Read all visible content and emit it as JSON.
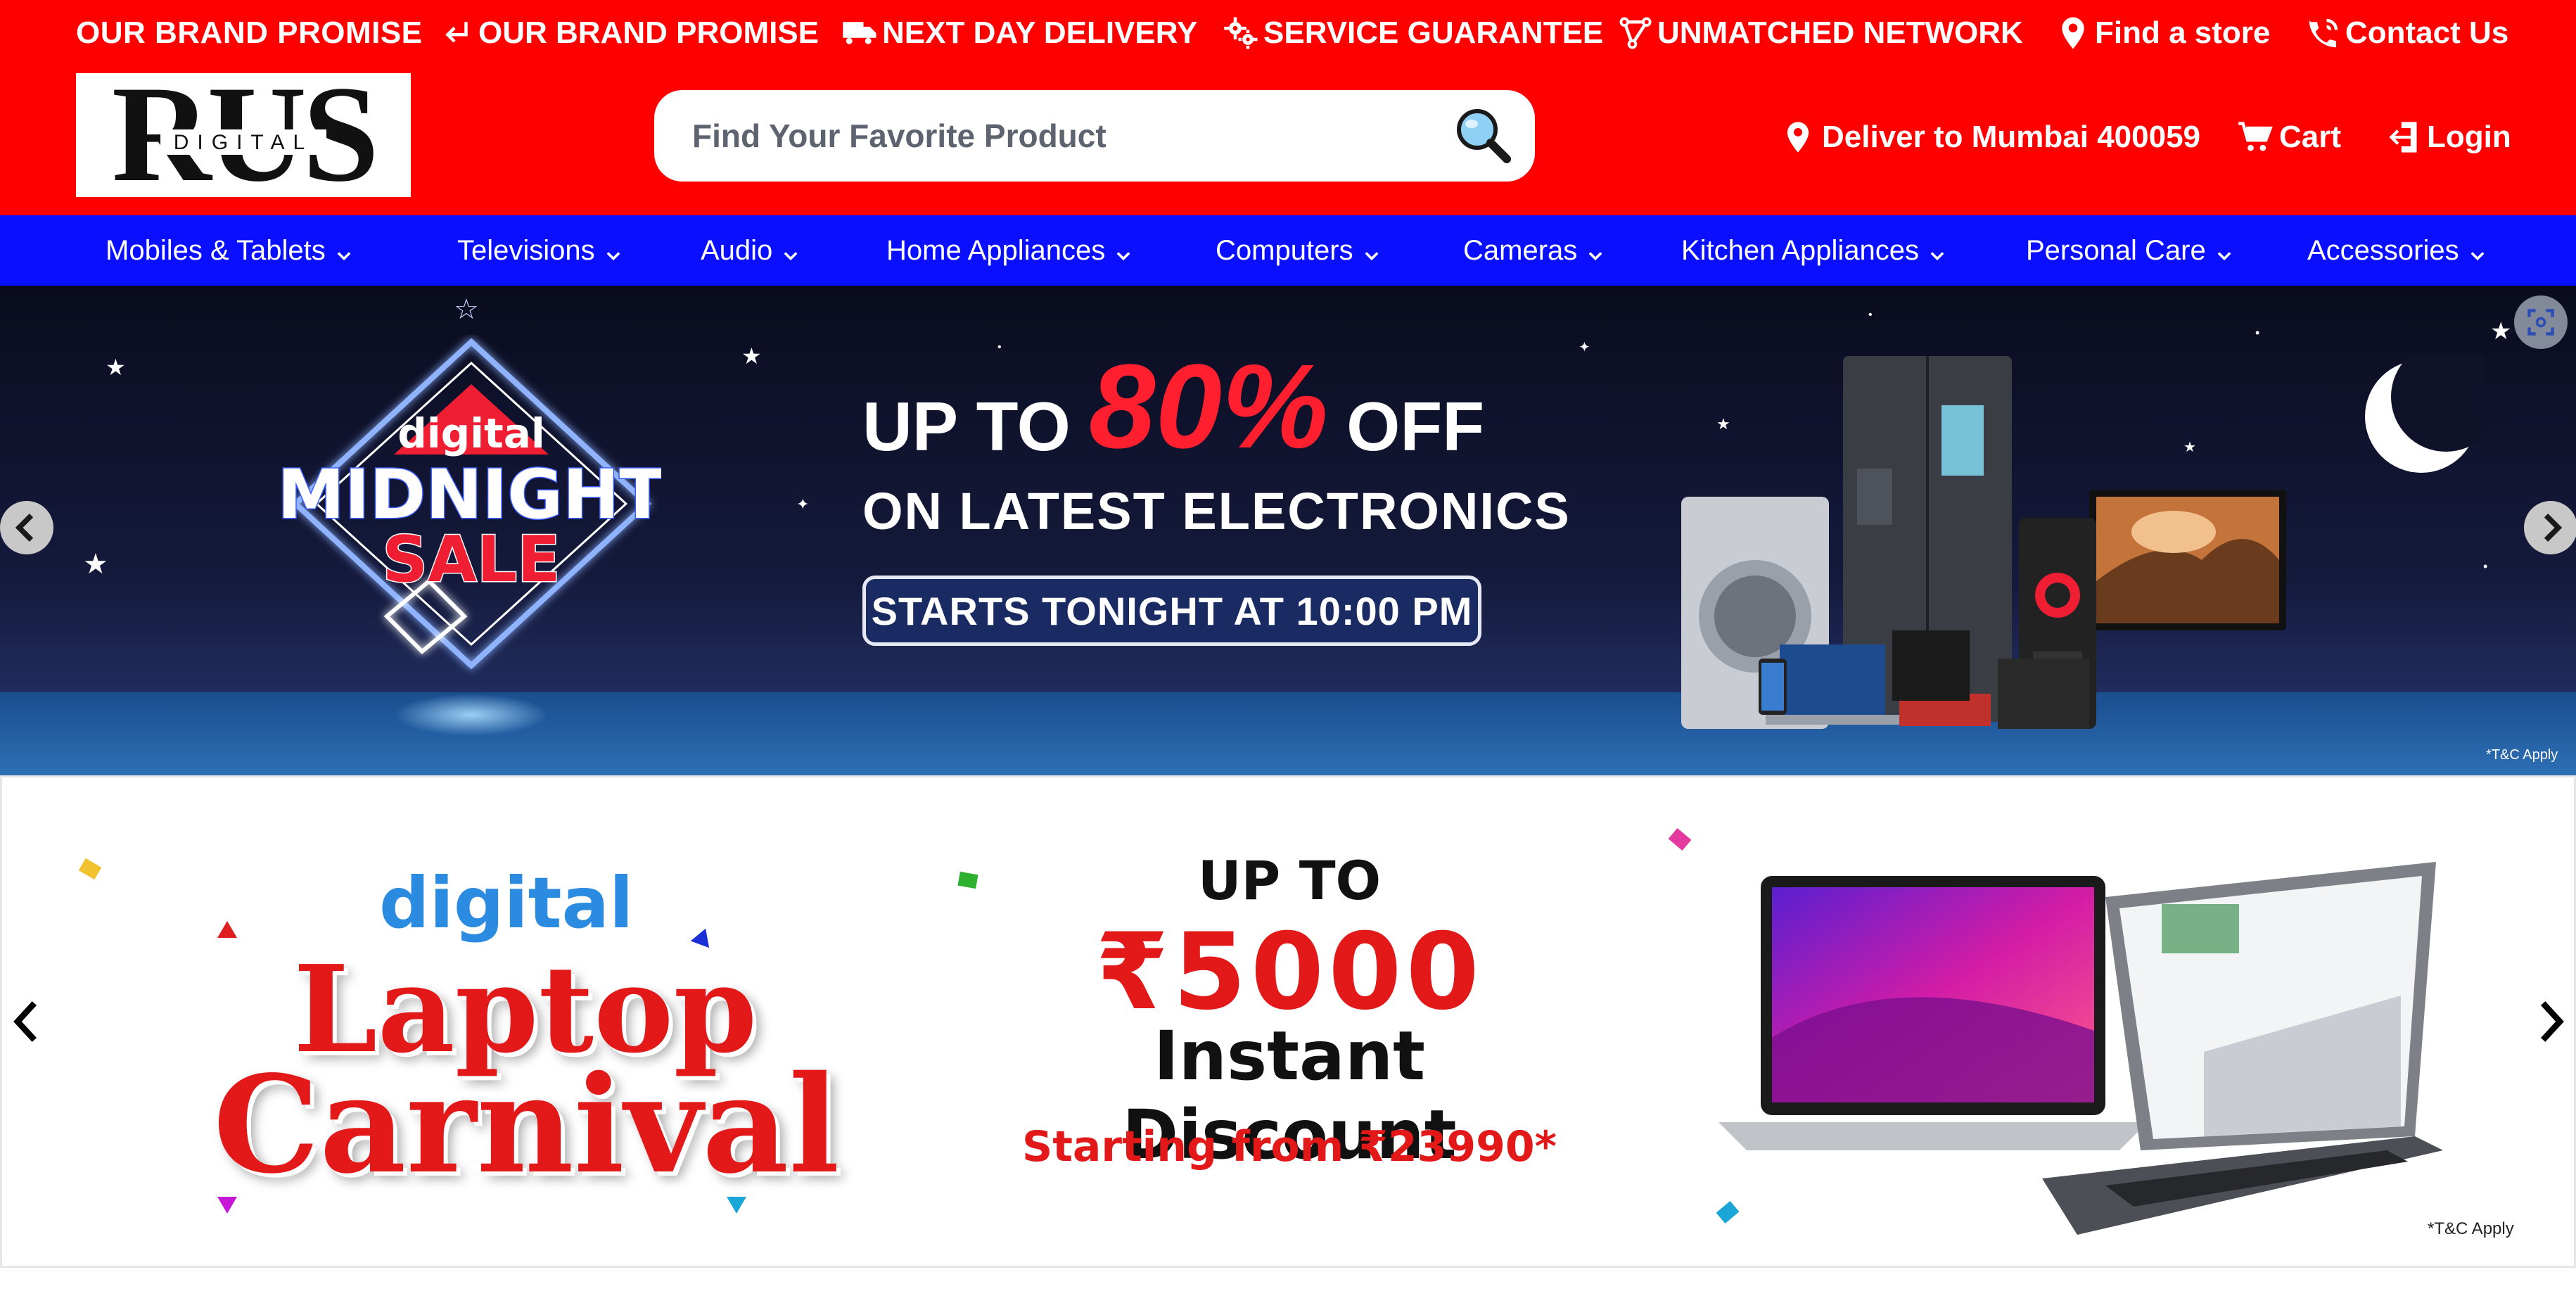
{
  "header": {
    "brand_promise_title": "OUR BRAND PROMISE",
    "topbar": [
      {
        "label": "OUR BRAND PROMISE",
        "icon": "return-arrow-icon"
      },
      {
        "label": "NEXT DAY DELIVERY",
        "icon": "truck-icon"
      },
      {
        "label": "SERVICE GUARANTEE",
        "icon": "gears-icon"
      },
      {
        "label": "UNMATCHED NETWORK",
        "icon": "network-icon"
      },
      {
        "label": "Find a store",
        "icon": "location-pin-icon"
      },
      {
        "label": "Contact Us",
        "icon": "contact-icon"
      }
    ],
    "logo": {
      "main": "RUS",
      "sub": "DIGITAL"
    },
    "search": {
      "placeholder": "Find Your Favorite Product",
      "value": ""
    },
    "deliver_to": "Deliver to Mumbai 400059",
    "cart_label": "Cart",
    "login_label": "Login"
  },
  "categories": [
    "Mobiles & Tablets",
    "Televisions",
    "Audio",
    "Home Appliances",
    "Computers",
    "Cameras",
    "Kitchen Appliances",
    "Personal Care",
    "Accessories"
  ],
  "banner1": {
    "logo_top": "digital",
    "logo_mid": "MIDNIGHT",
    "logo_bottom": "SALE",
    "upto": "UP TO",
    "percent": "80%",
    "off": "OFF",
    "line2": "ON LATEST ELECTRONICS",
    "cta": "STARTS TONIGHT AT 10:00 PM",
    "tnc": "*T&C Apply"
  },
  "banner2": {
    "digital": "digital",
    "laptop": "Laptop",
    "carnival": "Carnival",
    "upto": "UP TO",
    "amount": "₹5000",
    "instant": "Instant Discount",
    "from": "Starting from ₹23990*",
    "tnc": "*T&C Apply"
  },
  "colors": {
    "header_bg": "#ff0000",
    "nav_bg": "#0a10ff",
    "accent_red": "#e31818",
    "accent_blue": "#2a8be0"
  }
}
